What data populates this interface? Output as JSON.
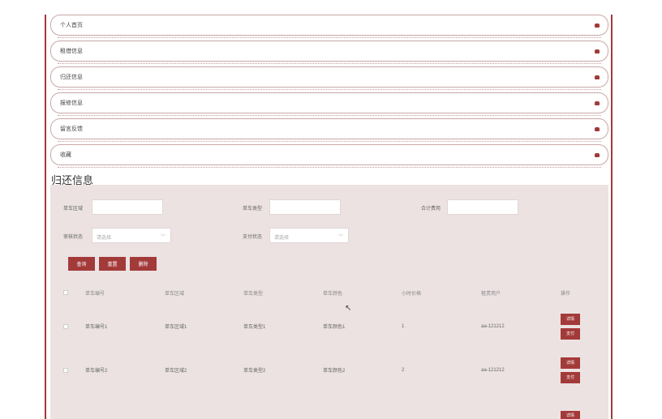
{
  "menu": {
    "items": [
      {
        "label": "个人首页"
      },
      {
        "label": "租借信息"
      },
      {
        "label": "归还信息"
      },
      {
        "label": "报修信息"
      },
      {
        "label": "留言反馈"
      },
      {
        "label": "收藏"
      }
    ]
  },
  "page": {
    "title": "归还信息"
  },
  "filters": {
    "region_label": "单车区域",
    "type_label": "单车类型",
    "fee_label": "合计费用",
    "review_label": "审核状态",
    "review_placeholder": "请选择",
    "pay_label": "支付状态",
    "pay_placeholder": "请选择"
  },
  "actions": {
    "query": "查询",
    "reset": "重置",
    "delete": "删除"
  },
  "table": {
    "headers": [
      "单车编号",
      "单车区域",
      "单车类型",
      "单车颜色",
      "小时价格",
      "租赁用户",
      "操作"
    ],
    "rows": [
      {
        "no": "单车编号1",
        "region": "单车区域1",
        "type": "单车类型1",
        "color": "单车颜色1",
        "price": "1",
        "user": "aa-121212",
        "detail": "详情",
        "pay": "支付"
      },
      {
        "no": "单车编号2",
        "region": "单车区域2",
        "type": "单车类型2",
        "color": "单车颜色2",
        "price": "2",
        "user": "aa-121212",
        "detail": "详情",
        "pay": "支付"
      },
      {
        "detail": "详情"
      }
    ]
  },
  "colors": {
    "accent": "#a33a3a",
    "panel_bg": "#ece2e2"
  },
  "icons": {
    "menu_bullet": "tag-icon",
    "cursor": "mouse-cursor-icon"
  }
}
